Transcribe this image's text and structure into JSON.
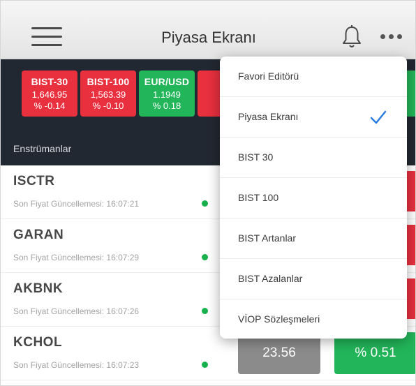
{
  "header": {
    "title": "Piyasa Ekranı",
    "menu_icon": "hamburger-icon",
    "bell_icon": "bell-icon",
    "more_icon": "more-icon"
  },
  "ticker": {
    "items": [
      {
        "name": "BIST-30",
        "value": "1,646.95",
        "change": "% -0.14",
        "color": "#e8303f"
      },
      {
        "name": "BIST-100",
        "value": "1,563.39",
        "change": "% -0.10",
        "color": "#e8303f"
      },
      {
        "name": "EUR/USD",
        "value": "1.1949",
        "change": "% 0.18",
        "color": "#22b559"
      },
      {
        "name": "U",
        "value": "7.",
        "change": "%",
        "color": "#e8303f"
      }
    ],
    "section_label": "Enstrümanlar"
  },
  "list": {
    "rows": [
      {
        "symbol": "ISCTR",
        "update": "Son Fiyat Güncellemesi: 16:07:21"
      },
      {
        "symbol": "GARAN",
        "update": "Son Fiyat Güncellemesi: 16:07:29"
      },
      {
        "symbol": "AKBNK",
        "update": "Son Fiyat Güncellemesi: 16:07:26"
      },
      {
        "symbol": "KCHOL",
        "update": "Son Fiyat Güncellemesi: 16:07:23",
        "price": "23.56",
        "change": "% 0.51"
      }
    ]
  },
  "menu": {
    "items": [
      {
        "label": "Favori Editörü",
        "selected": false
      },
      {
        "label": "Piyasa Ekranı",
        "selected": true
      },
      {
        "label": "BIST 30",
        "selected": false
      },
      {
        "label": "BIST 100",
        "selected": false
      },
      {
        "label": "BIST Artanlar",
        "selected": false
      },
      {
        "label": "BIST Azalanlar",
        "selected": false
      },
      {
        "label": "VİOP Sözleşmeleri",
        "selected": false
      }
    ],
    "check_color": "#2a7de1"
  }
}
